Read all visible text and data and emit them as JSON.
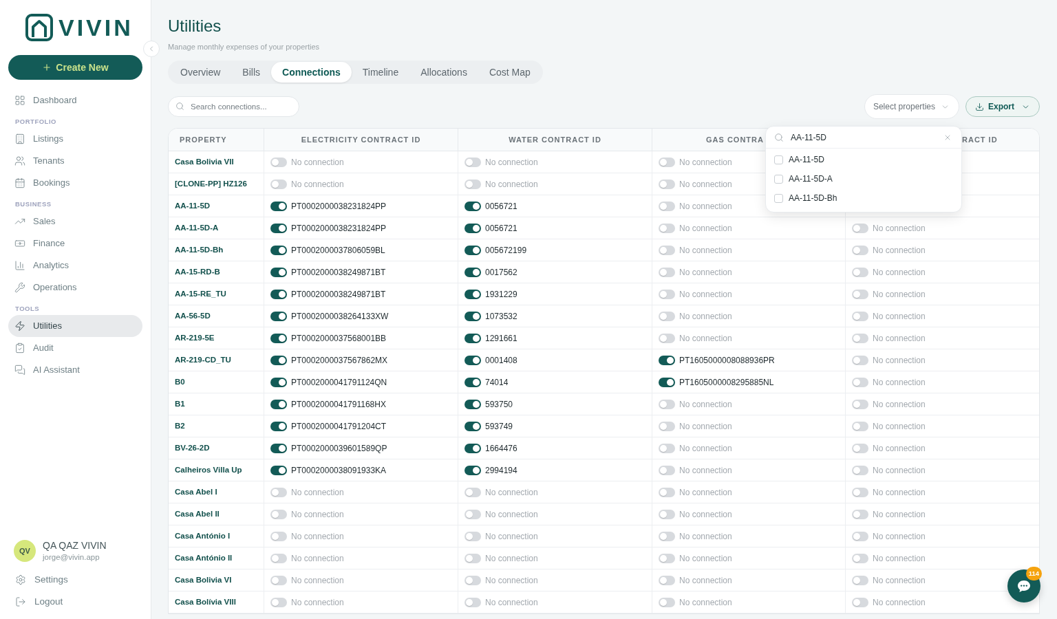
{
  "sidebar": {
    "logo": {
      "text": "VIVIN"
    },
    "create_button": {
      "label": "Create New"
    },
    "nav": [
      {
        "kind": "item",
        "label": "Dashboard",
        "selected": false
      },
      {
        "kind": "heading",
        "label": "PORTFOLIO"
      },
      {
        "kind": "item",
        "label": "Listings",
        "selected": false
      },
      {
        "kind": "item",
        "label": "Tenants",
        "selected": false
      },
      {
        "kind": "item",
        "label": "Bookings",
        "selected": false
      },
      {
        "kind": "heading",
        "label": "BUSINESS"
      },
      {
        "kind": "item",
        "label": "Sales",
        "selected": false
      },
      {
        "kind": "item",
        "label": "Finance",
        "selected": false
      },
      {
        "kind": "item",
        "label": "Analytics",
        "selected": false
      },
      {
        "kind": "item",
        "label": "Operations",
        "selected": false
      },
      {
        "kind": "heading",
        "label": "TOOLS"
      },
      {
        "kind": "item",
        "label": "Utilities",
        "selected": true
      },
      {
        "kind": "item",
        "label": "Audit",
        "selected": false
      },
      {
        "kind": "item",
        "label": "AI Assistant",
        "selected": false
      }
    ],
    "user": {
      "initials": "QV",
      "name": "QA QAZ VIVIN",
      "email": "jorge@vivin.app"
    },
    "footer_links": [
      "Settings",
      "Logout"
    ]
  },
  "header": {
    "title": "Utilities",
    "subtitle": "Manage monthly expenses of your properties"
  },
  "tabs": [
    {
      "label": "Overview",
      "selected": false
    },
    {
      "label": "Bills",
      "selected": false
    },
    {
      "label": "Connections",
      "selected": true
    },
    {
      "label": "Timeline",
      "selected": false
    },
    {
      "label": "Allocations",
      "selected": false
    },
    {
      "label": "Cost Map",
      "selected": false
    }
  ],
  "search": {
    "placeholder": "Search connections..."
  },
  "property_filter": {
    "label": "Select properties"
  },
  "export_button": {
    "label": "Export"
  },
  "table": {
    "columns": [
      "PROPERTY",
      "ELECTRICITY CONTRACT ID",
      "WATER CONTRACT ID",
      "GAS CONTRA",
      "RACT ID"
    ],
    "rows": [
      {
        "cells": [
          {
            "kind": "property",
            "text": "Casa Bolivia VII"
          },
          {
            "kind": "connection",
            "connected": false,
            "text": "No connection"
          },
          {
            "kind": "connection",
            "connected": false,
            "text": "No connection"
          },
          {
            "kind": "connection",
            "connected": false,
            "text": "No connection"
          }
        ]
      },
      {
        "cells": [
          {
            "kind": "property",
            "text": "[CLONE-PP] HZ126"
          },
          {
            "kind": "connection",
            "connected": false,
            "text": "No connection"
          },
          {
            "kind": "connection",
            "connected": false,
            "text": "No connection"
          },
          {
            "kind": "connection",
            "connected": false,
            "text": "No connection"
          }
        ]
      },
      {
        "cells": [
          {
            "kind": "property",
            "text": "AA-11-5D"
          },
          {
            "kind": "connection",
            "connected": true,
            "text": "PT0002000038231824PP"
          },
          {
            "kind": "connection",
            "connected": true,
            "text": "0056721"
          },
          {
            "kind": "connection",
            "connected": false,
            "text": "No connection"
          }
        ]
      },
      {
        "cells": [
          {
            "kind": "property",
            "text": "AA-11-5D-A"
          },
          {
            "kind": "connection",
            "connected": true,
            "text": "PT0002000038231824PP"
          },
          {
            "kind": "connection",
            "connected": true,
            "text": "0056721"
          },
          {
            "kind": "connection",
            "connected": false,
            "text": "No connection"
          },
          {
            "kind": "connection",
            "connected": false,
            "text": "No connection"
          }
        ]
      },
      {
        "cells": [
          {
            "kind": "property",
            "text": "AA-11-5D-Bh"
          },
          {
            "kind": "connection",
            "connected": true,
            "text": "PT0002000037806059BL"
          },
          {
            "kind": "connection",
            "connected": true,
            "text": "005672199"
          },
          {
            "kind": "connection",
            "connected": false,
            "text": "No connection"
          },
          {
            "kind": "connection",
            "connected": false,
            "text": "No connection"
          }
        ]
      },
      {
        "cells": [
          {
            "kind": "property",
            "text": "AA-15-RD-B"
          },
          {
            "kind": "connection",
            "connected": true,
            "text": "PT0002000038249871BT"
          },
          {
            "kind": "connection",
            "connected": true,
            "text": "0017562"
          },
          {
            "kind": "connection",
            "connected": false,
            "text": "No connection"
          },
          {
            "kind": "connection",
            "connected": false,
            "text": "No connection"
          }
        ]
      },
      {
        "cells": [
          {
            "kind": "property",
            "text": "AA-15-RE_TU"
          },
          {
            "kind": "connection",
            "connected": true,
            "text": "PT0002000038249871BT"
          },
          {
            "kind": "connection",
            "connected": true,
            "text": "1931229"
          },
          {
            "kind": "connection",
            "connected": false,
            "text": "No connection"
          },
          {
            "kind": "connection",
            "connected": false,
            "text": "No connection"
          }
        ]
      },
      {
        "cells": [
          {
            "kind": "property",
            "text": "AA-56-5D"
          },
          {
            "kind": "connection",
            "connected": true,
            "text": "PT0002000038264133XW"
          },
          {
            "kind": "connection",
            "connected": true,
            "text": "1073532"
          },
          {
            "kind": "connection",
            "connected": false,
            "text": "No connection"
          },
          {
            "kind": "connection",
            "connected": false,
            "text": "No connection"
          }
        ]
      },
      {
        "cells": [
          {
            "kind": "property",
            "text": "AR-219-5E"
          },
          {
            "kind": "connection",
            "connected": true,
            "text": "PT0002000037568001BB"
          },
          {
            "kind": "connection",
            "connected": true,
            "text": "1291661"
          },
          {
            "kind": "connection",
            "connected": false,
            "text": "No connection"
          },
          {
            "kind": "connection",
            "connected": false,
            "text": "No connection"
          }
        ]
      },
      {
        "cells": [
          {
            "kind": "property",
            "text": "AR-219-CD_TU"
          },
          {
            "kind": "connection",
            "connected": true,
            "text": "PT0002000037567862MX"
          },
          {
            "kind": "connection",
            "connected": true,
            "text": "0001408"
          },
          {
            "kind": "connection",
            "connected": true,
            "text": "PT1605000008088936PR"
          },
          {
            "kind": "connection",
            "connected": false,
            "text": "No connection"
          }
        ]
      },
      {
        "cells": [
          {
            "kind": "property",
            "text": "B0"
          },
          {
            "kind": "connection",
            "connected": true,
            "text": "PT0002000041791124QN"
          },
          {
            "kind": "connection",
            "connected": true,
            "text": "74014"
          },
          {
            "kind": "connection",
            "connected": true,
            "text": "PT1605000008295885NL"
          },
          {
            "kind": "connection",
            "connected": false,
            "text": "No connection"
          }
        ]
      },
      {
        "cells": [
          {
            "kind": "property",
            "text": "B1"
          },
          {
            "kind": "connection",
            "connected": true,
            "text": "PT0002000041791168HX"
          },
          {
            "kind": "connection",
            "connected": true,
            "text": "593750"
          },
          {
            "kind": "connection",
            "connected": false,
            "text": "No connection"
          },
          {
            "kind": "connection",
            "connected": false,
            "text": "No connection"
          }
        ]
      },
      {
        "cells": [
          {
            "kind": "property",
            "text": "B2"
          },
          {
            "kind": "connection",
            "connected": true,
            "text": "PT0002000041791204CT"
          },
          {
            "kind": "connection",
            "connected": true,
            "text": "593749"
          },
          {
            "kind": "connection",
            "connected": false,
            "text": "No connection"
          },
          {
            "kind": "connection",
            "connected": false,
            "text": "No connection"
          }
        ]
      },
      {
        "cells": [
          {
            "kind": "property",
            "text": "BV-26-2D"
          },
          {
            "kind": "connection",
            "connected": true,
            "text": "PT0002000039601589QP"
          },
          {
            "kind": "connection",
            "connected": true,
            "text": "1664476"
          },
          {
            "kind": "connection",
            "connected": false,
            "text": "No connection"
          },
          {
            "kind": "connection",
            "connected": false,
            "text": "No connection"
          }
        ]
      },
      {
        "cells": [
          {
            "kind": "property",
            "text": "Calheiros Villa Up"
          },
          {
            "kind": "connection",
            "connected": true,
            "text": "PT0002000038091933KA"
          },
          {
            "kind": "connection",
            "connected": true,
            "text": "2994194"
          },
          {
            "kind": "connection",
            "connected": false,
            "text": "No connection"
          },
          {
            "kind": "connection",
            "connected": false,
            "text": "No connection"
          }
        ]
      },
      {
        "cells": [
          {
            "kind": "property",
            "text": "Casa Abel I"
          },
          {
            "kind": "connection",
            "connected": false,
            "text": "No connection"
          },
          {
            "kind": "connection",
            "connected": false,
            "text": "No connection"
          },
          {
            "kind": "connection",
            "connected": false,
            "text": "No connection"
          },
          {
            "kind": "connection",
            "connected": false,
            "text": "No connection"
          }
        ]
      },
      {
        "cells": [
          {
            "kind": "property",
            "text": "Casa Abel II"
          },
          {
            "kind": "connection",
            "connected": false,
            "text": "No connection"
          },
          {
            "kind": "connection",
            "connected": false,
            "text": "No connection"
          },
          {
            "kind": "connection",
            "connected": false,
            "text": "No connection"
          },
          {
            "kind": "connection",
            "connected": false,
            "text": "No connection"
          }
        ]
      },
      {
        "cells": [
          {
            "kind": "property",
            "text": "Casa António I"
          },
          {
            "kind": "connection",
            "connected": false,
            "text": "No connection"
          },
          {
            "kind": "connection",
            "connected": false,
            "text": "No connection"
          },
          {
            "kind": "connection",
            "connected": false,
            "text": "No connection"
          },
          {
            "kind": "connection",
            "connected": false,
            "text": "No connection"
          }
        ]
      },
      {
        "cells": [
          {
            "kind": "property",
            "text": "Casa António II"
          },
          {
            "kind": "connection",
            "connected": false,
            "text": "No connection"
          },
          {
            "kind": "connection",
            "connected": false,
            "text": "No connection"
          },
          {
            "kind": "connection",
            "connected": false,
            "text": "No connection"
          },
          {
            "kind": "connection",
            "connected": false,
            "text": "No connection"
          }
        ]
      },
      {
        "cells": [
          {
            "kind": "property",
            "text": "Casa Bolivia VI"
          },
          {
            "kind": "connection",
            "connected": false,
            "text": "No connection"
          },
          {
            "kind": "connection",
            "connected": false,
            "text": "No connection"
          },
          {
            "kind": "connection",
            "connected": false,
            "text": "No connection"
          },
          {
            "kind": "connection",
            "connected": false,
            "text": "No connection"
          }
        ]
      },
      {
        "cells": [
          {
            "kind": "property",
            "text": "Casa Bolívia VIII"
          },
          {
            "kind": "connection",
            "connected": false,
            "text": "No connection"
          },
          {
            "kind": "connection",
            "connected": false,
            "text": "No connection"
          },
          {
            "kind": "connection",
            "connected": false,
            "text": "No connection"
          },
          {
            "kind": "connection",
            "connected": false,
            "text": "No connection"
          }
        ]
      }
    ]
  },
  "property_dropdown": {
    "query": "AA-11-5D",
    "options": [
      {
        "label": "AA-11-5D",
        "checked": false
      },
      {
        "label": "AA-11-5D-A",
        "checked": false
      },
      {
        "label": "AA-11-5D-Bh",
        "checked": false
      }
    ]
  },
  "chat": {
    "badge": "114"
  }
}
